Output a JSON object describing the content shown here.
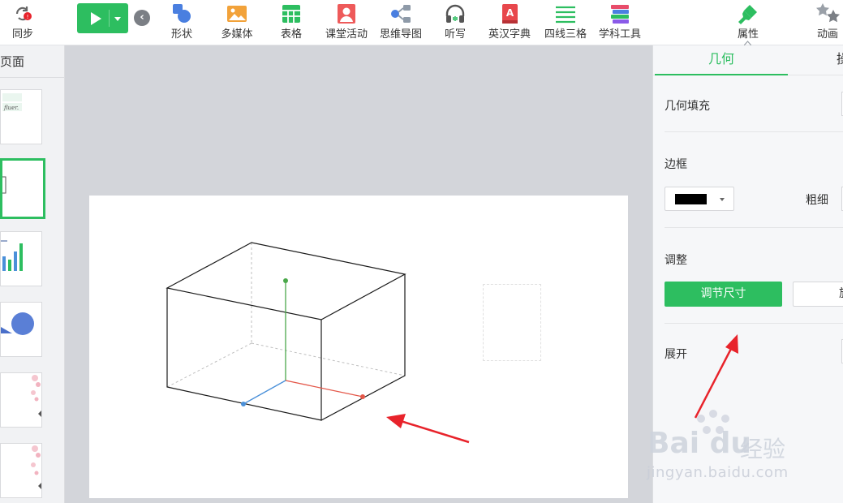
{
  "toolbar": {
    "sync_label": "同步",
    "items": [
      {
        "label": "形状"
      },
      {
        "label": "多媒体"
      },
      {
        "label": "表格"
      },
      {
        "label": "课堂活动"
      },
      {
        "label": "思维导图"
      },
      {
        "label": "听写"
      },
      {
        "label": "英汉字典"
      },
      {
        "label": "四线三格"
      },
      {
        "label": "学科工具"
      }
    ],
    "right_tabs": [
      {
        "label": "属性"
      },
      {
        "label": "动画"
      }
    ],
    "back_glyph": "‹"
  },
  "left_panel": {
    "title": "页面",
    "thumb1_text": "fluer."
  },
  "right_panel": {
    "tab_active": "几何",
    "tab_other": "操",
    "fill_label": "几何填充",
    "border_label": "边框",
    "border_color": "#000000",
    "thickness_label": "粗细",
    "adjust_label": "调整",
    "resize_button": "调节尺寸",
    "rotate_button": "旋转",
    "expand_label": "展开"
  },
  "watermark": {
    "logo": "Bai du",
    "cn": "经验",
    "url": "jingyan.baidu.com"
  },
  "colors": {
    "accent": "#2dbe60",
    "annotation": "#e8232b",
    "axis_x": "#e4584a",
    "axis_y": "#4aa84a",
    "axis_z": "#4a90d9"
  }
}
